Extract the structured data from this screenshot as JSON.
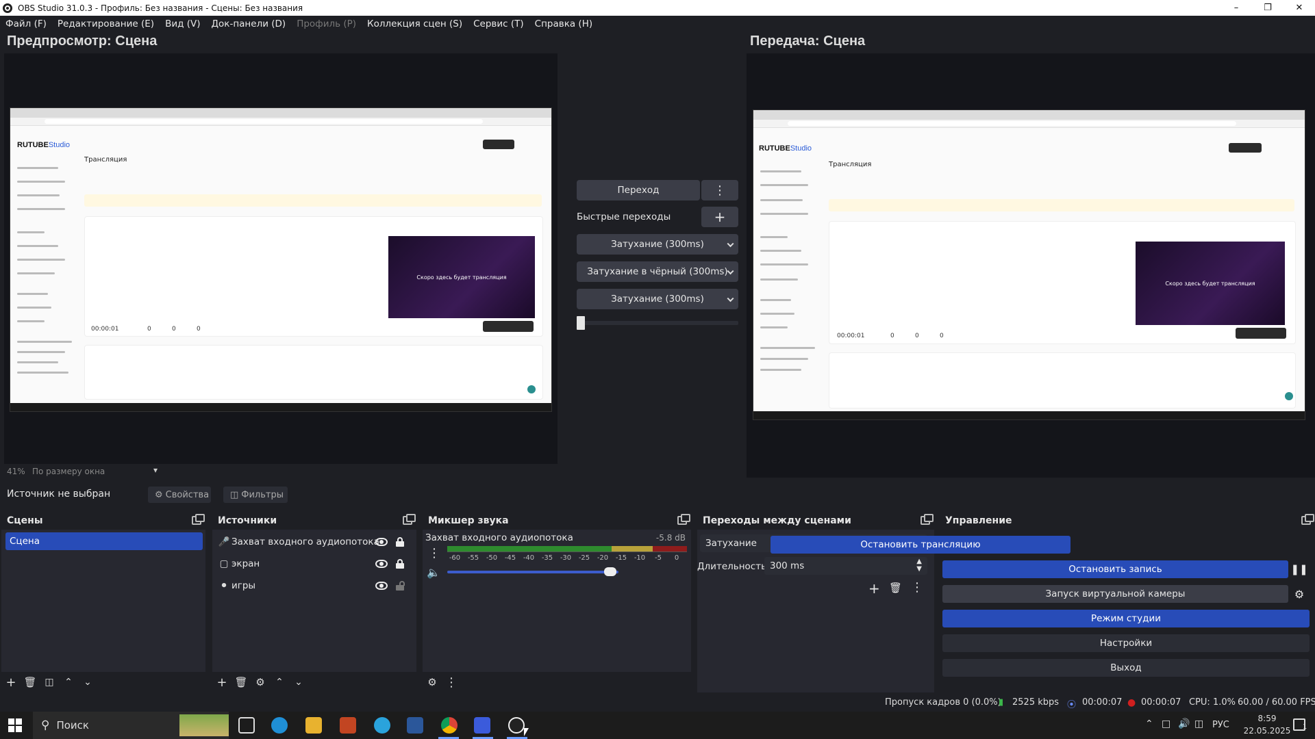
{
  "window": {
    "title": "OBS Studio 31.0.3 - Профиль: Без названия - Сцены: Без названия",
    "controls": [
      "minimize-icon",
      "restore-icon",
      "close-icon"
    ]
  },
  "menu": [
    {
      "label": "Файл (F)",
      "enabled": true
    },
    {
      "label": "Редактирование (E)",
      "enabled": true
    },
    {
      "label": "Вид (V)",
      "enabled": true
    },
    {
      "label": "Док-панели (D)",
      "enabled": true
    },
    {
      "label": "Профиль (P)",
      "enabled": false
    },
    {
      "label": "Коллекция сцен (S)",
      "enabled": true
    },
    {
      "label": "Сервис (T)",
      "enabled": true
    },
    {
      "label": "Справка (H)",
      "enabled": true
    }
  ],
  "preview": {
    "title": "Предпросмотр: Сцена",
    "zoom": "41%",
    "fit_label": "По размеру окна"
  },
  "program": {
    "title": "Передача: Сцена"
  },
  "captured_page": {
    "logo": "RUTUBE",
    "logo_suffix": "Studio",
    "heading": "Трансляция",
    "video_text": "Скоро здесь будет трансляция",
    "duration": "00:00:01",
    "views": "0",
    "likes": "0",
    "dislikes": "0"
  },
  "transition_panel": {
    "transition_button": "Переход",
    "quick_label": "Быстрые переходы",
    "quick_items": [
      "Затухание (300ms)",
      "Затухание в чёрный (300ms)",
      "Затухание (300ms)"
    ],
    "tbar_level": 0
  },
  "source_bar": {
    "selected_label": "Источник не выбран",
    "properties": "Свойства",
    "filters": "Фильтры"
  },
  "scenes": {
    "title": "Сцены",
    "items": [
      "Сцена"
    ]
  },
  "sources": {
    "title": "Источники",
    "items": [
      {
        "name": "Захват входного аудиопотока",
        "icon": "microphone-icon",
        "visible": true,
        "locked": true
      },
      {
        "name": "экран",
        "icon": "monitor-icon",
        "visible": true,
        "locked": true
      },
      {
        "name": "игры",
        "icon": "gamepad-icon",
        "visible": true,
        "locked": false
      }
    ]
  },
  "mixer": {
    "title": "Микшер звука",
    "channel": "Захват входного аудиопотока",
    "db": "-5.8 dB",
    "ticks": [
      "-60",
      "-55",
      "-50",
      "-45",
      "-40",
      "-35",
      "-30",
      "-25",
      "-20",
      "-15",
      "-10",
      "-5",
      "0"
    ],
    "volume_level": 0.95
  },
  "scene_transitions": {
    "title": "Переходы между сценами",
    "selected": "Затухание",
    "duration_label": "Длительность",
    "duration_value": "300 ms"
  },
  "controls": {
    "title": "Управление",
    "stop_stream": "Остановить трансляцию",
    "stop_record": "Остановить запись",
    "virtual_cam": "Запуск виртуальной камеры",
    "studio_mode": "Режим студии",
    "settings": "Настройки",
    "exit": "Выход"
  },
  "status": {
    "dropped": "Пропуск кадров 0 (0.0%)",
    "bitrate": "2525 kbps",
    "stream_time": "00:00:07",
    "record_time": "00:00:07",
    "cpu": "CPU: 1.0%",
    "fps": "60.00 / 60.00 FPS"
  },
  "taskbar": {
    "search_placeholder": "Поиск",
    "language": "РУС",
    "time": "8:59",
    "date": "22.05.2025",
    "notifications": "1"
  },
  "colors": {
    "accent": "#284cb8",
    "panel": "#272830",
    "background": "#1e1f24",
    "record_red": "#d01f1f",
    "meter_green": "#2e8b2e",
    "meter_yellow": "#b8a23a",
    "meter_red": "#8e1c1c"
  }
}
